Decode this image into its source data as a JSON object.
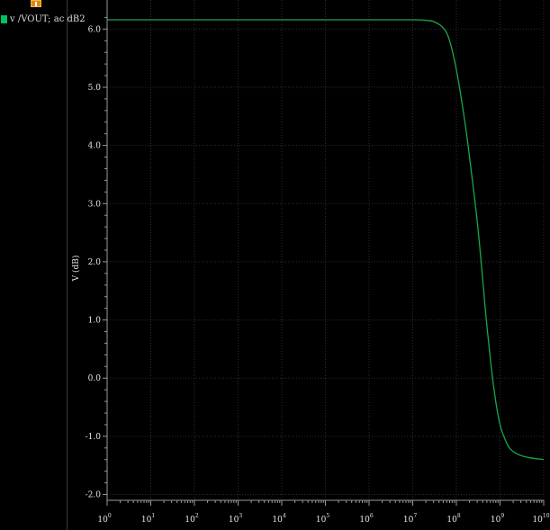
{
  "legend": {
    "trace_label": "v /VOUT; ac dB2",
    "trace_color": "#00c060"
  },
  "marker_icon": "marker-pin-icon",
  "colors": {
    "background": "#000000",
    "grid": "#2e2e2e",
    "axis": "#9a9a9a",
    "trace": "#1aa84a"
  },
  "chart_data": {
    "type": "line",
    "title": "",
    "xlabel": "",
    "ylabel": "V (dB)",
    "x_scale": "log",
    "xlim": [
      1,
      10000000000
    ],
    "ylim": [
      -2.1,
      6.5
    ],
    "y_ticks": [
      6.0,
      5.0,
      4.0,
      3.0,
      2.0,
      1.0,
      0.0,
      -1.0,
      -2.0
    ],
    "y_tick_labels": [
      "6.0",
      "5.0",
      "4.0",
      "3.0",
      "2.0",
      "1.0",
      "0.0",
      "-1.0",
      "-2.0"
    ],
    "x_tick_labels": [
      {
        "base": "10",
        "exp": "0"
      },
      {
        "base": "10",
        "exp": "1"
      },
      {
        "base": "10",
        "exp": "2"
      },
      {
        "base": "10",
        "exp": "3"
      },
      {
        "base": "10",
        "exp": "4"
      },
      {
        "base": "10",
        "exp": "5"
      },
      {
        "base": "10",
        "exp": "6"
      },
      {
        "base": "10",
        "exp": "7"
      },
      {
        "base": "10",
        "exp": "8"
      },
      {
        "base": "10",
        "exp": "9"
      },
      {
        "base": "10",
        "exp": "10"
      }
    ],
    "grid": true,
    "series": [
      {
        "name": "v /VOUT; ac dB2",
        "color": "#1aa84a",
        "x": [
          1,
          10,
          100,
          1000,
          10000,
          100000,
          1000000,
          10000000,
          20000000,
          30000000,
          50000000,
          70000000,
          100000000,
          150000000,
          200000000,
          300000000,
          400000000,
          500000000,
          700000000,
          1000000000,
          1500000000,
          2000000000,
          3000000000,
          5000000000,
          10000000000
        ],
        "y": [
          6.16,
          6.16,
          6.16,
          6.16,
          6.16,
          6.16,
          6.16,
          6.16,
          6.15,
          6.13,
          6.02,
          5.8,
          5.3,
          4.5,
          3.8,
          2.7,
          1.7,
          0.9,
          -0.1,
          -0.8,
          -1.15,
          -1.26,
          -1.33,
          -1.37,
          -1.4
        ]
      }
    ]
  }
}
